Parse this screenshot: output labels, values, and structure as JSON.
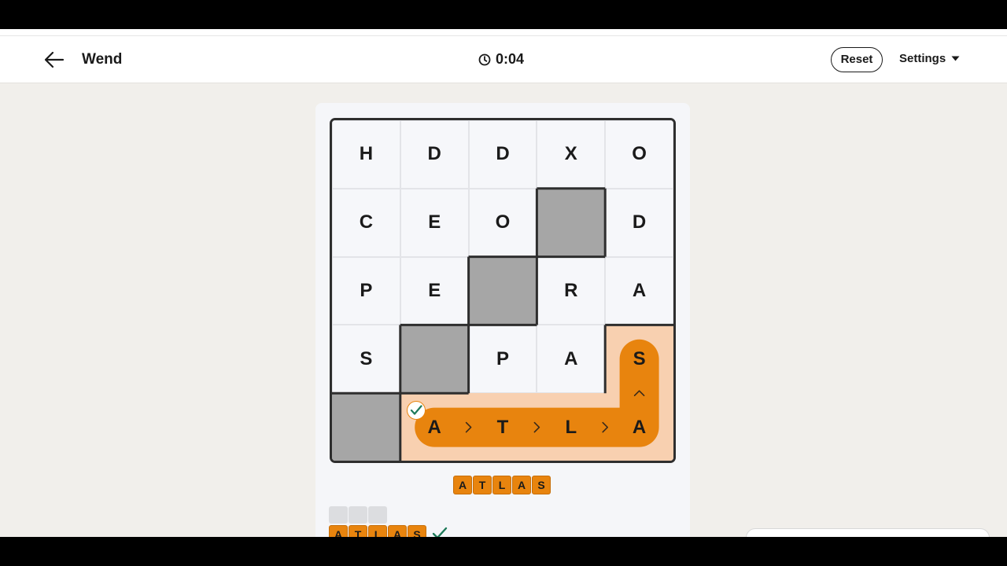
{
  "header": {
    "title": "Wend",
    "timer": "0:04",
    "reset_label": "Reset",
    "settings_label": "Settings"
  },
  "board": {
    "rows": [
      [
        "H",
        "D",
        "D",
        "X",
        "O"
      ],
      [
        "C",
        "E",
        "O",
        "",
        "D"
      ],
      [
        "P",
        "E",
        "",
        "R",
        "A"
      ],
      [
        "S",
        "",
        "P",
        "A",
        "S"
      ],
      [
        "",
        "A",
        "T",
        "L",
        "A"
      ]
    ],
    "blocked": [
      [
        1,
        3
      ],
      [
        2,
        2
      ],
      [
        3,
        1
      ],
      [
        4,
        0
      ]
    ],
    "found_path": {
      "word": "ATLAS",
      "cells": [
        [
          4,
          1
        ],
        [
          4,
          2
        ],
        [
          4,
          3
        ],
        [
          4,
          4
        ],
        [
          3,
          4
        ]
      ]
    }
  },
  "current_word": [
    "A",
    "T",
    "L",
    "A",
    "S"
  ],
  "history": {
    "empty_slots": 3,
    "found": [
      {
        "letters": [
          "A",
          "T",
          "L",
          "A",
          "S"
        ],
        "status": "correct"
      }
    ]
  },
  "colors": {
    "accent": "#e8840e",
    "highlight": "#f8d0b0",
    "block": "#a6a6a6",
    "check": "#1e7a5a"
  }
}
